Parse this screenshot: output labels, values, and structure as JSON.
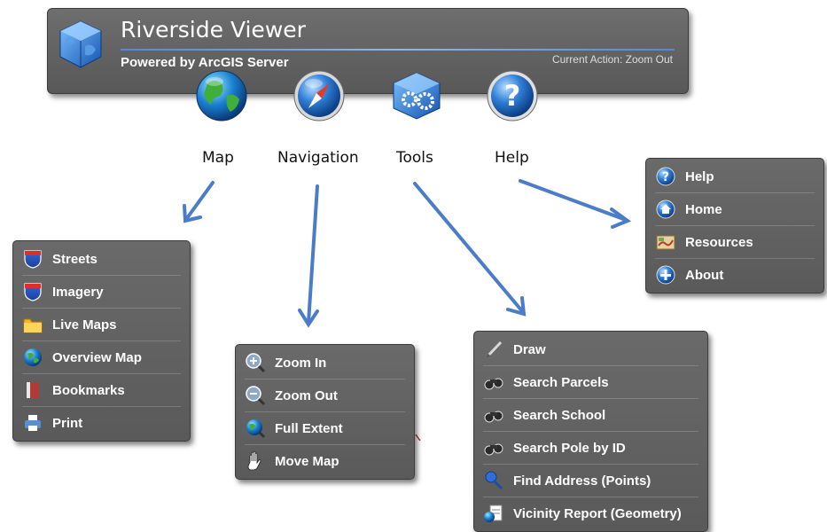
{
  "header": {
    "title": "Riverside Viewer",
    "subtitle": "Powered by ArcGIS Server",
    "current_action": "Current Action: Zoom Out"
  },
  "toolbar": [
    {
      "label": "Map",
      "icon": "globe-icon"
    },
    {
      "label": "Navigation",
      "icon": "compass-icon"
    },
    {
      "label": "Tools",
      "icon": "gears-icon"
    },
    {
      "label": "Help",
      "icon": "question-icon"
    }
  ],
  "menus": {
    "map": [
      {
        "label": "Streets",
        "icon": "shield-icon"
      },
      {
        "label": "Imagery",
        "icon": "shield-icon"
      },
      {
        "label": "Live Maps",
        "icon": "folder-icon"
      },
      {
        "label": "Overview Map",
        "icon": "globe-small-icon"
      },
      {
        "label": "Bookmarks",
        "icon": "bookmark-icon"
      },
      {
        "label": "Print",
        "icon": "printer-icon"
      }
    ],
    "navigation": [
      {
        "label": "Zoom In",
        "icon": "zoom-in-icon"
      },
      {
        "label": "Zoom Out",
        "icon": "zoom-out-icon"
      },
      {
        "label": "Full Extent",
        "icon": "full-extent-icon"
      },
      {
        "label": "Move Map",
        "icon": "hand-icon"
      }
    ],
    "tools": [
      {
        "label": "Draw",
        "icon": "pencil-icon"
      },
      {
        "label": "Search Parcels",
        "icon": "binoculars-icon"
      },
      {
        "label": "Search School",
        "icon": "binoculars-icon"
      },
      {
        "label": "Search Pole by ID",
        "icon": "binoculars-icon"
      },
      {
        "label": "Find Address (Points)",
        "icon": "pushpin-icon"
      },
      {
        "label": "Vicinity Report (Geometry)",
        "icon": "report-icon"
      }
    ],
    "help": [
      {
        "label": "Help",
        "icon": "help-small-icon"
      },
      {
        "label": "Home",
        "icon": "home-icon"
      },
      {
        "label": "Resources",
        "icon": "resources-icon"
      },
      {
        "label": "About",
        "icon": "about-icon"
      }
    ]
  }
}
